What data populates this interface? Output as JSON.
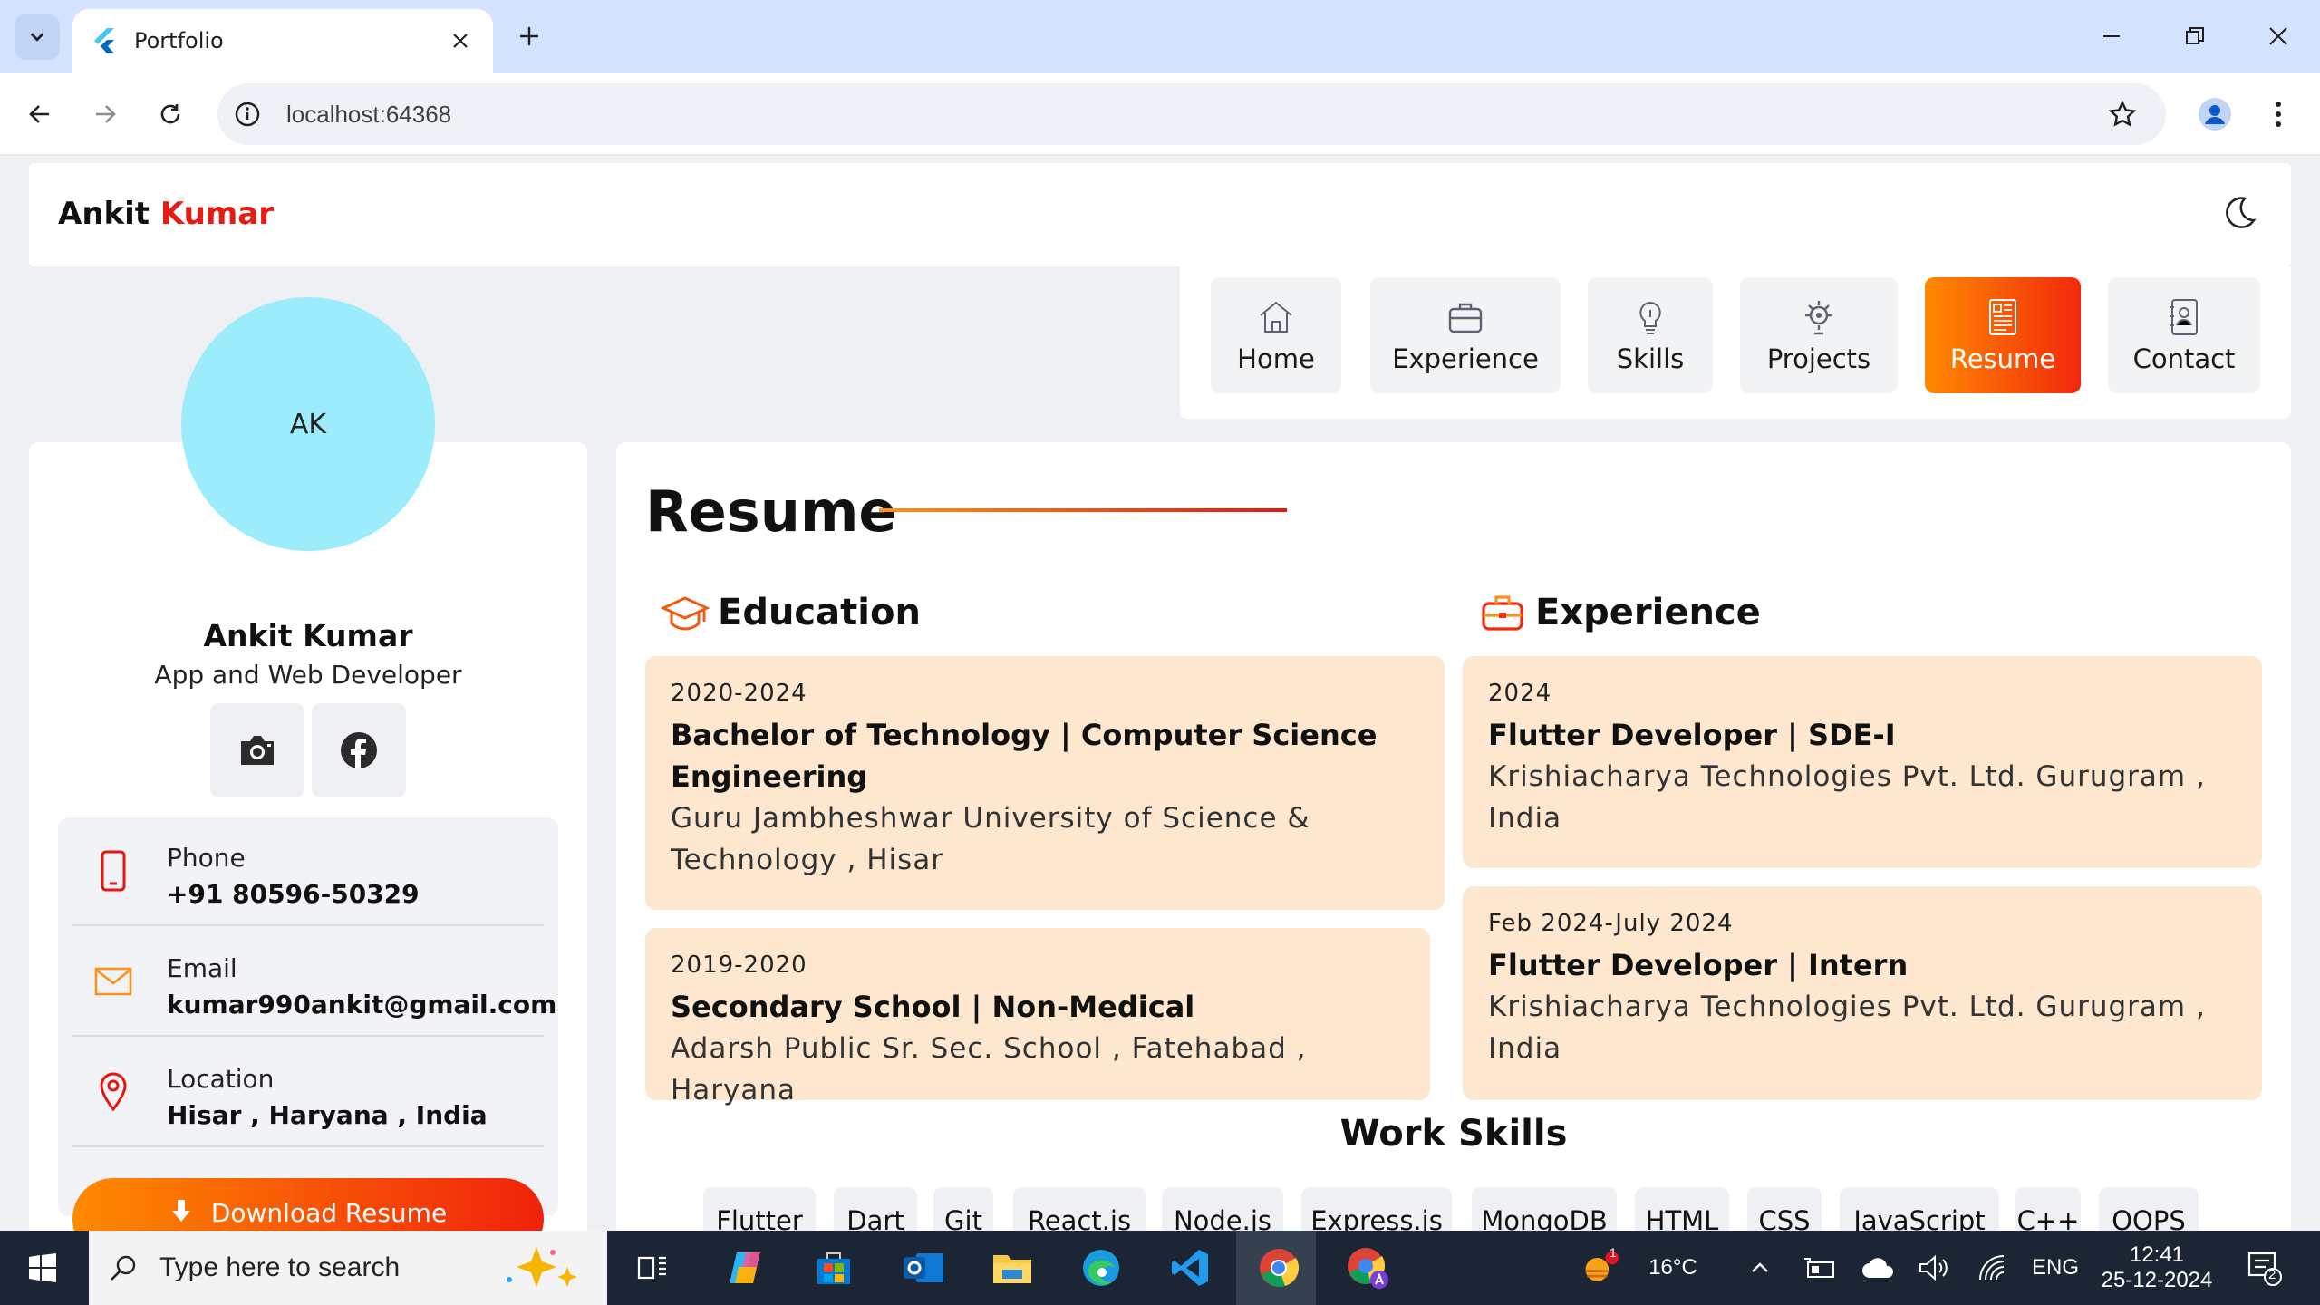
{
  "browser": {
    "tab_title": "Portfolio",
    "url": "localhost:64368"
  },
  "site": {
    "brand_first": "Ankit",
    "brand_last": "Kumar",
    "nav": [
      "Home",
      "Experience",
      "Skills",
      "Projects",
      "Resume",
      "Contact"
    ],
    "active_nav": "Resume"
  },
  "profile": {
    "initials": "AK",
    "name": "Ankit Kumar",
    "role": "App and Web Developer",
    "contacts": [
      {
        "label": "Phone",
        "value": "+91 80596-50329",
        "icon": "phone-icon"
      },
      {
        "label": "Email",
        "value": "kumar990ankit@gmail.com",
        "icon": "mail-icon"
      },
      {
        "label": "Location",
        "value": "Hisar , Haryana , India",
        "icon": "location-pin-icon"
      }
    ],
    "download_label": "Download Resume"
  },
  "resume": {
    "title": "Resume",
    "education_heading": "Education",
    "experience_heading": "Experience",
    "education": [
      {
        "years": "2020-2024",
        "degree_line1": "Bachelor of Technology | Computer Science",
        "degree_line2": "Engineering",
        "inst_line1": "Guru Jambheshwar University of Science &",
        "inst_line2": "Technology , Hisar"
      },
      {
        "years": "2019-2020",
        "degree_line1": "Secondary School | Non-Medical",
        "inst_line1": "Adarsh Public Sr. Sec. School , Fatehabad , Haryana"
      }
    ],
    "experience": [
      {
        "years": "2024",
        "role": "Flutter Developer | SDE-I",
        "company_line1": "Krishiacharya Technologies Pvt. Ltd. Gurugram ,",
        "company_line2": "India"
      },
      {
        "years": "Feb 2024-July 2024",
        "role": "Flutter Developer | Intern",
        "company_line1": "Krishiacharya Technologies Pvt. Ltd. Gurugram ,",
        "company_line2": "India"
      }
    ],
    "work_skills_title": "Work Skills",
    "skills": [
      "Flutter",
      "Dart",
      "Git",
      "React.js",
      "Node.js",
      "Express.js",
      "MongoDB",
      "HTML",
      "CSS",
      "JavaScript",
      "C++",
      "OOPS"
    ]
  },
  "taskbar": {
    "search_placeholder": "Type here to search",
    "temperature": "16°C",
    "weather_badge": "1",
    "language": "ENG",
    "time": "12:41",
    "date": "25-12-2024",
    "notification_count": "2"
  },
  "colors": {
    "accent_orange": "#ff8a00",
    "accent_red": "#e51c12",
    "entry_bg": "#fde8cf",
    "avatar_bg": "#9cecfb"
  }
}
